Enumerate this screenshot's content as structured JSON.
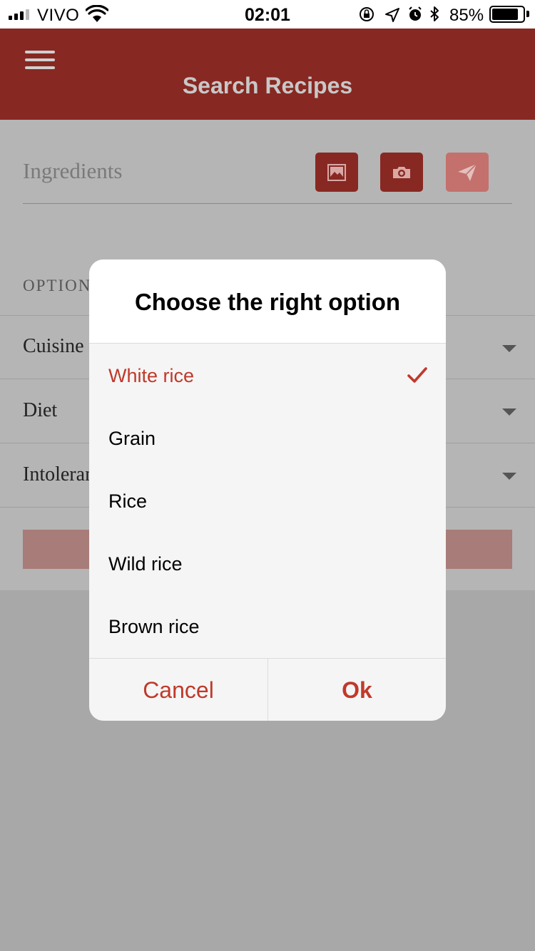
{
  "status_bar": {
    "carrier": "VIVO",
    "time": "02:01",
    "battery_percent": "85%",
    "battery_level": 0.85,
    "icons": [
      "signal-icon",
      "wifi-icon",
      "orientation-lock-icon",
      "location-icon",
      "alarm-icon",
      "bluetooth-icon",
      "battery-icon"
    ]
  },
  "app_bar": {
    "title": "Search Recipes",
    "menu_icon": "menu-icon"
  },
  "search": {
    "placeholder": "Ingredients",
    "buttons": [
      {
        "icon": "image-icon",
        "enabled": true
      },
      {
        "icon": "camera-icon",
        "enabled": true
      },
      {
        "icon": "send-icon",
        "enabled": false
      }
    ]
  },
  "options": {
    "label": "OPTION",
    "rows": [
      {
        "label": "Cuisine"
      },
      {
        "label": "Diet"
      },
      {
        "label": "Intoleran"
      }
    ]
  },
  "dialog": {
    "title": "Choose the right option",
    "selected": "White rice",
    "items": [
      {
        "label": "White rice",
        "selected": true
      },
      {
        "label": "Grain",
        "selected": false
      },
      {
        "label": "Rice",
        "selected": false
      },
      {
        "label": "Wild rice",
        "selected": false
      },
      {
        "label": "Brown rice",
        "selected": false
      }
    ],
    "cancel_label": "Cancel",
    "ok_label": "Ok"
  },
  "colors": {
    "primary": "#882822",
    "accent": "#c0392b",
    "overlay_bg": "#b5b5b5",
    "dialog_bg": "#f5f5f5"
  }
}
